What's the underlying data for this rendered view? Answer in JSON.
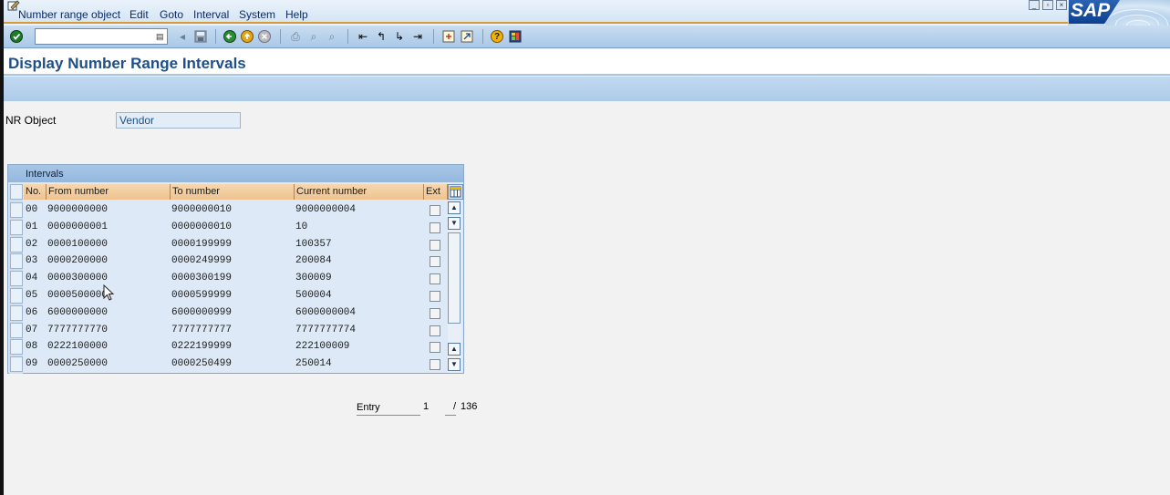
{
  "menu": {
    "items": [
      {
        "label": "Number range object"
      },
      {
        "label": "Edit"
      },
      {
        "label": "Goto"
      },
      {
        "label": "Interval"
      },
      {
        "label": "System"
      },
      {
        "label": "Help"
      }
    ]
  },
  "window_buttons": [
    "minimize",
    "restore",
    "close"
  ],
  "logo": {
    "text": "SAP"
  },
  "toolbar": {
    "command_value": "",
    "icons": [
      "enter-icon",
      "back-icon",
      "exit-icon",
      "cancel-icon",
      "print-icon",
      "find-icon",
      "find-next-icon",
      "first-page-icon",
      "previous-page-icon",
      "next-page-icon",
      "last-page-icon",
      "create-session-icon",
      "shortcut-icon",
      "help-icon",
      "layout-menu-icon"
    ]
  },
  "page": {
    "title": "Display Number Range Intervals"
  },
  "nr_object": {
    "label": "NR Object",
    "value": "Vendor"
  },
  "intervals": {
    "title": "Intervals",
    "columns": [
      "No.",
      "From number",
      "To number",
      "Current number",
      "Ext"
    ],
    "rows": [
      {
        "no": "00",
        "from": "9000000000",
        "to": "9000000010",
        "current": "9000000004"
      },
      {
        "no": "01",
        "from": "0000000001",
        "to": "0000000010",
        "current": "10"
      },
      {
        "no": "02",
        "from": "0000100000",
        "to": "0000199999",
        "current": "100357"
      },
      {
        "no": "03",
        "from": "0000200000",
        "to": "0000249999",
        "current": "200084"
      },
      {
        "no": "04",
        "from": "0000300000",
        "to": "0000300199",
        "current": "300009"
      },
      {
        "no": "05",
        "from": "0000500000",
        "to": "0000599999",
        "current": "500004"
      },
      {
        "no": "06",
        "from": "6000000000",
        "to": "6000000999",
        "current": "6000000004"
      },
      {
        "no": "07",
        "from": "7777777770",
        "to": "7777777777",
        "current": "7777777774"
      },
      {
        "no": "08",
        "from": "0222100000",
        "to": "0222199999",
        "current": "222100009"
      },
      {
        "no": "09",
        "from": "0000250000",
        "to": "0000250499",
        "current": "250014"
      }
    ]
  },
  "entry": {
    "label": "Entry",
    "current": "1",
    "separator": "/",
    "total": "136"
  },
  "colors": {
    "title": "#1f4f87",
    "menu_text": "#0b2a6a",
    "header_orange": "#efc390",
    "table_bg": "#dde9f6",
    "separator_line": "#d49a3b"
  }
}
